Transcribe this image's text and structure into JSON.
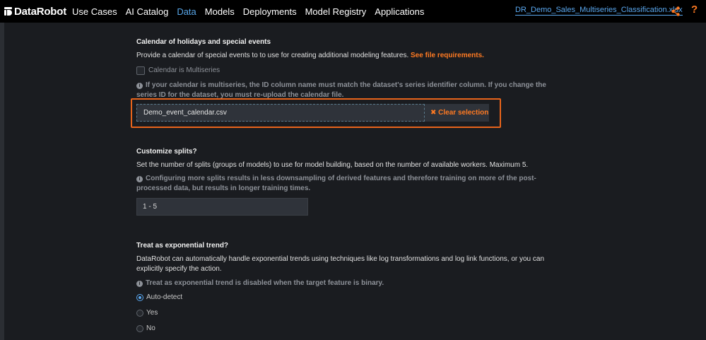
{
  "app": {
    "logo_text": "DataRobot",
    "nav": [
      {
        "label": "Use Cases"
      },
      {
        "label": "AI Catalog"
      },
      {
        "label": "Data"
      },
      {
        "label": "Models"
      },
      {
        "label": "Deployments"
      },
      {
        "label": "Model Registry"
      },
      {
        "label": "Applications"
      }
    ],
    "active_nav": "Data",
    "dataset_link": "DR_Demo_Sales_Multiseries_Classification.xlsx",
    "help_glyph": "?",
    "icons": {
      "share": "share-icon",
      "help": "help-icon"
    },
    "accent_color": "#ff7a22",
    "link_color": "#5aa8f0"
  },
  "calendar": {
    "title": "Calendar of holidays and special events",
    "description": "Provide a calendar of special events to to use for creating additional modeling features.",
    "requirements_link": "See file requirements.",
    "multiseries_checkbox_label": "Calendar is Multiseries",
    "multiseries_checked": false,
    "note": "If your calendar is multiseries, the ID column name must match the dataset's series identifier column. If you change the series ID for the dataset, you must re-upload the calendar file.",
    "file_name": "Demo_event_calendar.csv",
    "clear_button": "Clear selection"
  },
  "splits": {
    "title": "Customize splits?",
    "description": "Set the number of splits (groups of models) to use for model building, based on the number of available workers. Maximum 5.",
    "note": "Configuring more splits results in less downsampling of derived features and therefore training on more of the post-processed data, but results in longer training times.",
    "value": "1 - 5"
  },
  "trend": {
    "title": "Treat as exponential trend?",
    "description": "DataRobot can automatically handle exponential trends using techniques like log transformations and log link functions, or you can explicitly specify the action.",
    "note": "Treat as exponential trend is disabled when the target feature is binary.",
    "options": [
      {
        "label": "Auto-detect",
        "selected": true
      },
      {
        "label": "Yes",
        "selected": false
      },
      {
        "label": "No",
        "selected": false
      }
    ]
  }
}
